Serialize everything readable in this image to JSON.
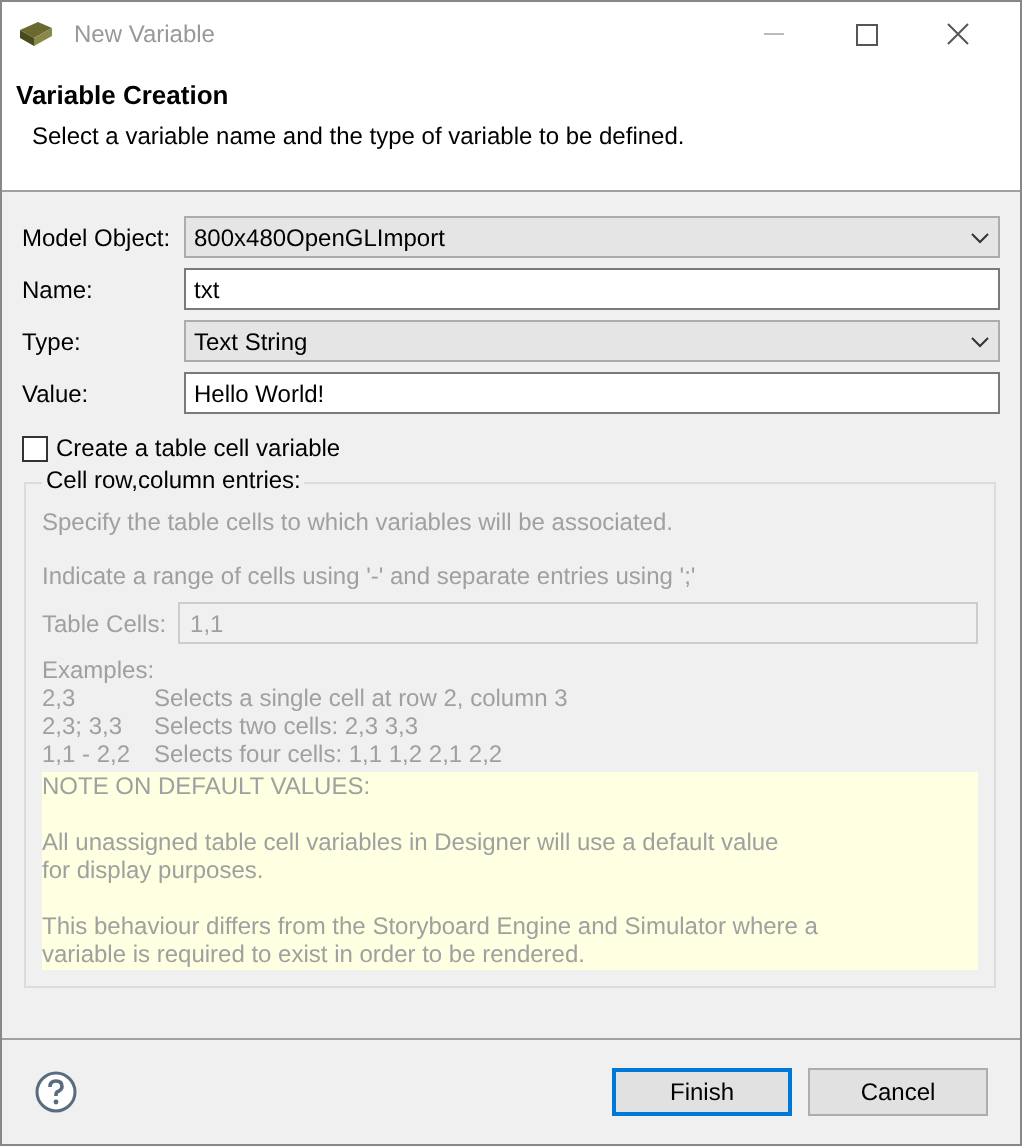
{
  "window": {
    "title": "New Variable"
  },
  "header": {
    "title": "Variable Creation",
    "description": "Select a variable name and the type of variable to be defined."
  },
  "fields": [
    {
      "label": "Model Object:",
      "kind": "combo",
      "value": "800x480OpenGLImport"
    },
    {
      "label": "Name:",
      "kind": "text",
      "value": "txt"
    },
    {
      "label": "Type:",
      "kind": "combo",
      "value": "Text String"
    },
    {
      "label": "Value:",
      "kind": "text",
      "value": "Hello World!"
    }
  ],
  "table_cell_checkbox": {
    "label": "Create a table cell variable",
    "checked": false
  },
  "cell_group": {
    "title": "Cell row,column entries:",
    "disabled": true,
    "instructions": [
      "Specify the table cells to which variables will be associated.",
      "Indicate a range of cells using '-' and separate entries using ';'"
    ],
    "table_cells": {
      "label": "Table Cells:",
      "value": "1,1"
    },
    "examples_title": "Examples:",
    "examples": [
      {
        "pattern": "2,3",
        "description": "Selects a single cell at row 2, column 3"
      },
      {
        "pattern": "2,3; 3,3",
        "description": "Selects two cells: 2,3 3,3"
      },
      {
        "pattern": "1,1 - 2,2",
        "description": "Selects four cells: 1,1 1,2 2,1 2,2"
      }
    ],
    "note": [
      "NOTE ON DEFAULT VALUES:",
      "All unassigned table cell variables in Designer will use a default value\nfor display purposes.",
      "This behaviour differs from the Storyboard Engine and Simulator where a\nvariable is required to exist in order to be rendered."
    ]
  },
  "buttons": [
    {
      "label": "Finish",
      "default": true
    },
    {
      "label": "Cancel",
      "default": false
    }
  ]
}
